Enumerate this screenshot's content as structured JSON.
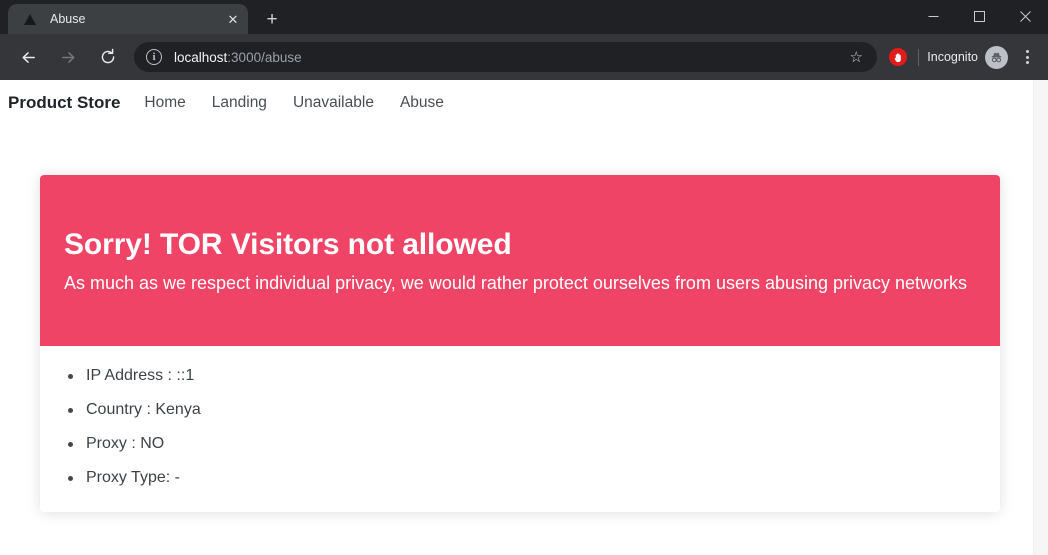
{
  "browser": {
    "tab": {
      "title": "Abuse",
      "favicon_icon": "triangle-favicon",
      "close_icon": "✕"
    },
    "new_tab_label": "+",
    "window_controls": {
      "minimize": "minimize-icon",
      "maximize": "maximize-icon",
      "close": "close-icon"
    },
    "toolbar": {
      "back_icon": "←",
      "forward_icon": "→",
      "reload_icon": "⟳",
      "site_info_icon": "i",
      "url_host": "localhost",
      "url_path": ":3000/abuse",
      "bookmark_icon": "☆",
      "extension_icon": "✋",
      "profile_label": "Incognito",
      "incognito_icon": "incognito-spy-icon",
      "menu_icon": "three-dots-icon"
    }
  },
  "page": {
    "navbar": {
      "brand": "Product Store",
      "links": [
        {
          "label": "Home"
        },
        {
          "label": "Landing"
        },
        {
          "label": "Unavailable"
        },
        {
          "label": "Abuse"
        }
      ]
    },
    "alert": {
      "title": "Sorry! TOR Visitors not allowed",
      "message": "As much as we respect individual privacy, we would rather protect ourselves from users abusing privacy networks",
      "background_color": "#ef4466",
      "text_color": "#ffffff"
    },
    "details": [
      {
        "text": "IP Address : ::1"
      },
      {
        "text": "Country : Kenya"
      },
      {
        "text": "Proxy : NO"
      },
      {
        "text": "Proxy Type: -"
      }
    ]
  }
}
